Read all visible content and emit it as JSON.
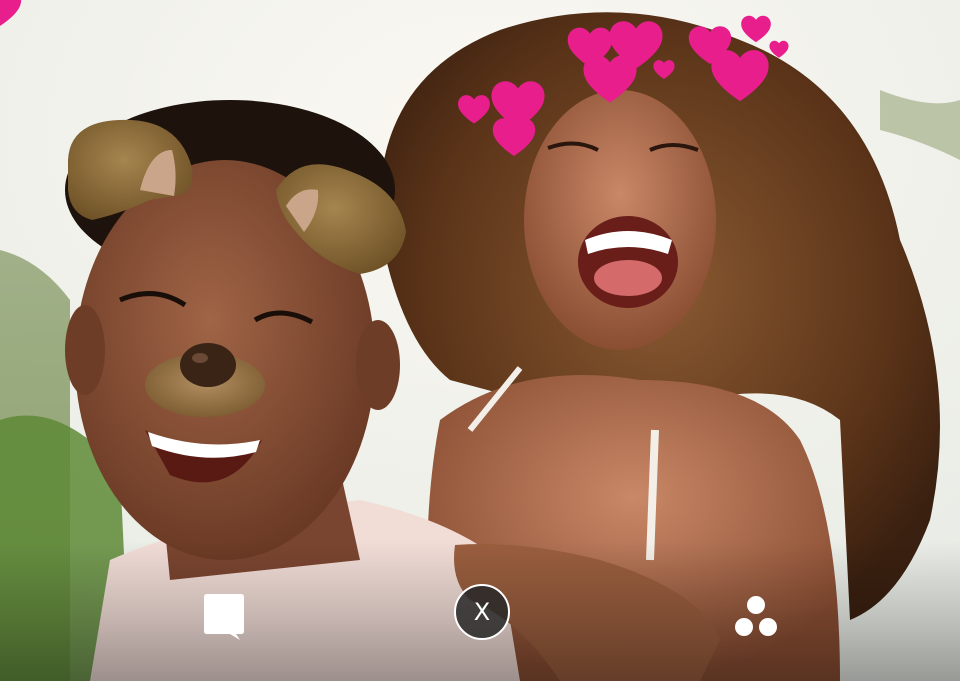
{
  "screen": {
    "type": "camera-preview",
    "active_lenses": [
      "dog-ears-lens",
      "heart-crown-lens"
    ]
  },
  "toolbar": {
    "chat_icon": "chat-bubble-icon",
    "close_label": "X",
    "close_icon": "close-icon",
    "lenses_icon": "lens-carousel-icon"
  },
  "colors": {
    "heart": "#e81e8c",
    "ear": "#8a6a3a",
    "close_bg": "#282828",
    "icon": "#ffffff"
  }
}
